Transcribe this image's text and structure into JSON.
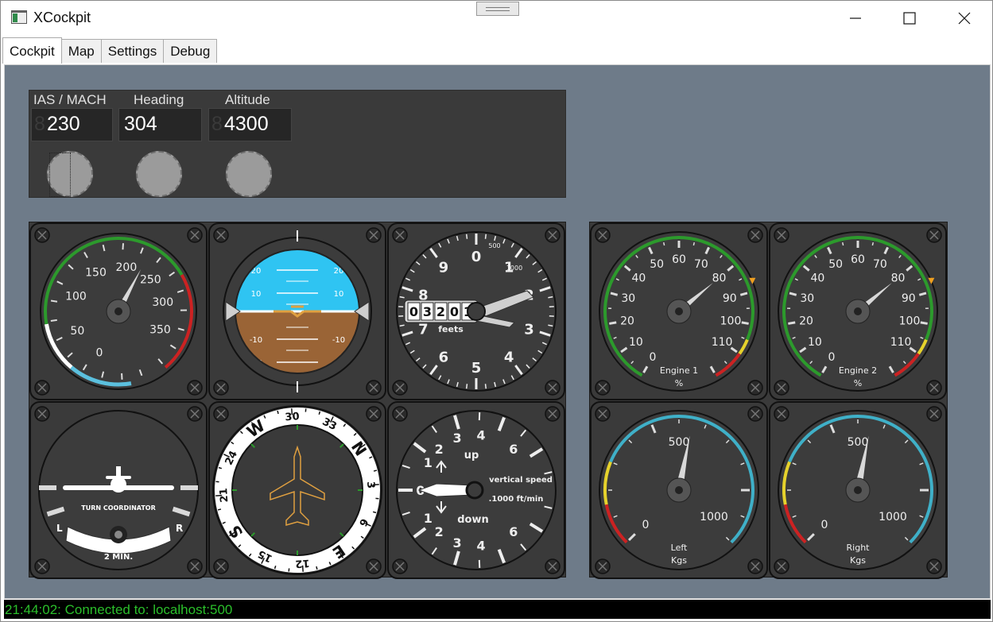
{
  "window": {
    "title": "XCockpit"
  },
  "tabs": [
    {
      "label": "Cockpit",
      "active": true
    },
    {
      "label": "Map",
      "active": false
    },
    {
      "label": "Settings",
      "active": false
    },
    {
      "label": "Debug",
      "active": false
    }
  ],
  "autopilot": {
    "ias": {
      "label": "IAS / MACH",
      "ghost": "8",
      "value": "230"
    },
    "heading": {
      "label": "Heading",
      "value": "304"
    },
    "altitude": {
      "label": "Altitude",
      "ghost": "8",
      "value": "4300"
    }
  },
  "airspeed": {
    "ticks": [
      "0",
      "50",
      "100",
      "150",
      "200",
      "250",
      "300",
      "350"
    ]
  },
  "attitude": {
    "pitch_marks": [
      "20",
      "10",
      "-10",
      "-20"
    ]
  },
  "altimeter": {
    "digits": [
      "0",
      "1",
      "2",
      "3",
      "4",
      "5",
      "6",
      "7",
      "8",
      "9"
    ],
    "counter": [
      "0",
      "3",
      "2",
      "0",
      "1"
    ],
    "unit": "feets",
    "mini_500": "500",
    "mini_1000": "1000"
  },
  "turn_coordinator": {
    "label": "TURN COORDINATOR",
    "left": "L",
    "right": "R",
    "time": "2 MIN."
  },
  "heading_indicator": {
    "labels": [
      "N",
      "3",
      "6",
      "E",
      "12",
      "15",
      "S",
      "21",
      "24",
      "W",
      "30",
      "33"
    ]
  },
  "vsi": {
    "up": "up",
    "down": "down",
    "title": "vertical speed",
    "unit": ".1000 ft/min"
  },
  "engines": [
    {
      "name": "Engine 1",
      "unit": "%",
      "ticks": [
        "0",
        "10",
        "20",
        "30",
        "40",
        "50",
        "60",
        "70",
        "80",
        "90",
        "100",
        "110"
      ],
      "value": 80
    },
    {
      "name": "Engine 2",
      "unit": "%",
      "ticks": [
        "0",
        "10",
        "20",
        "30",
        "40",
        "50",
        "60",
        "70",
        "80",
        "90",
        "100",
        "110"
      ],
      "value": 80
    }
  ],
  "fuel": [
    {
      "name": "Left",
      "unit": "Kgs",
      "ticks": [
        "0",
        "500",
        "1000"
      ],
      "value": 650
    },
    {
      "name": "Right",
      "unit": "Kgs",
      "ticks": [
        "0",
        "500",
        "1000"
      ],
      "value": 650
    }
  ],
  "status": {
    "text": "21:44:02: Connected to: localhost:500"
  },
  "colors": {
    "background": "#6e7b89",
    "status_text": "#2bbf2b"
  }
}
